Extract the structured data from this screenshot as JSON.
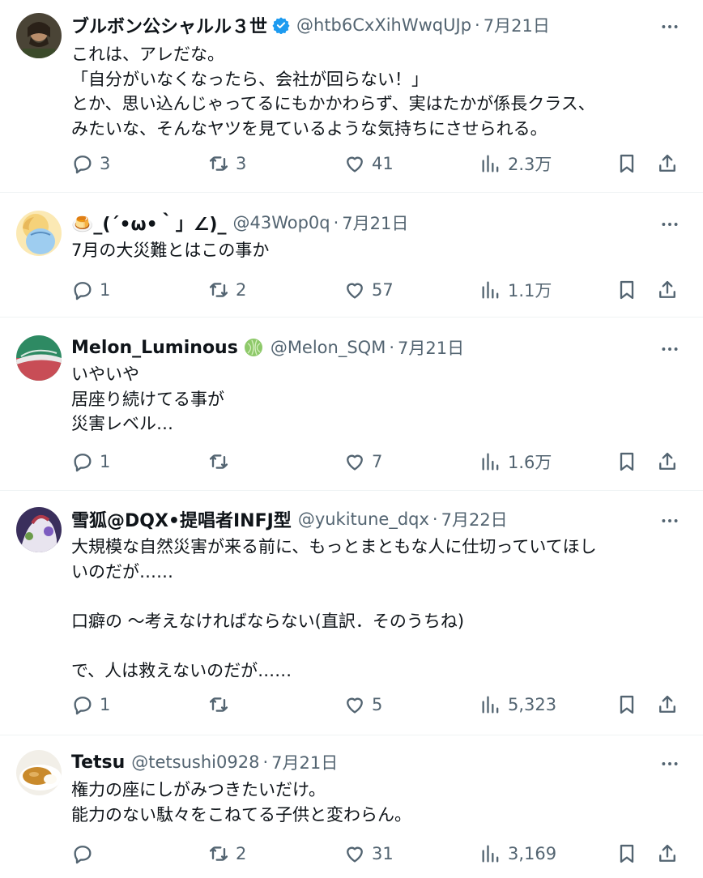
{
  "tweets": [
    {
      "name": "ブルボン公シャルル３世",
      "verified": true,
      "emoji": "",
      "handle": "@htb6CxXihWwqUJp",
      "sep": "·",
      "date": "7月21日",
      "text": "これは、アレだな。\n「自分がいなくなったら、会社が回らない！」\nとか、思い込んじゃってるにもかかわらず、実はたかが係長クラス、\nみたいな、そんなヤツを見ているような気持ちにさせられる。",
      "replies": "3",
      "reposts": "3",
      "likes": "41",
      "views": "2.3万"
    },
    {
      "name": "🍮_(´•ω•｀」∠)_",
      "verified": false,
      "emoji": "",
      "handle": "@43Wop0q",
      "sep": "·",
      "date": "7月21日",
      "text": "7月の大災難とはこの事か",
      "replies": "1",
      "reposts": "2",
      "likes": "57",
      "views": "1.1万"
    },
    {
      "name": "Melon_Luminous",
      "verified": false,
      "emoji": "melon-emoji",
      "handle": "@Melon_SQM",
      "sep": "·",
      "date": "7月21日",
      "text": "いやいや\n居座り続けてる事が\n災害レベル…",
      "replies": "1",
      "reposts": "",
      "likes": "7",
      "views": "1.6万"
    },
    {
      "name": "雪狐@DQX•提唱者INFJ型",
      "verified": false,
      "emoji": "",
      "handle": "@yukitune_dqx",
      "sep": "·",
      "date": "7月22日",
      "text": "大規模な自然災害が来る前に、もっとまともな人に仕切っていてほし\nいのだが……\n\n口癖の 〜考えなければならない(直訳．そのうちね)\n\nで、人は救えないのだが……",
      "replies": "1",
      "reposts": "",
      "likes": "5",
      "views": "5,323"
    },
    {
      "name": "Tetsu",
      "verified": false,
      "emoji": "",
      "handle": "@tetsushi0928",
      "sep": "·",
      "date": "7月21日",
      "text": "権力の座にしがみつきたいだけ。\n能力のない駄々をこねてる子供と変わらん。",
      "replies": "",
      "reposts": "2",
      "likes": "31",
      "views": "3,169"
    }
  ],
  "colors": {
    "text": "#0f1419",
    "secondary": "#536471",
    "verified": "#1d9bf0",
    "divider": "#eff3f4"
  },
  "icons": [
    "reply-icon",
    "repost-icon",
    "like-icon",
    "views-icon",
    "bookmark-icon",
    "share-icon",
    "more-icon",
    "verified-badge-icon"
  ]
}
